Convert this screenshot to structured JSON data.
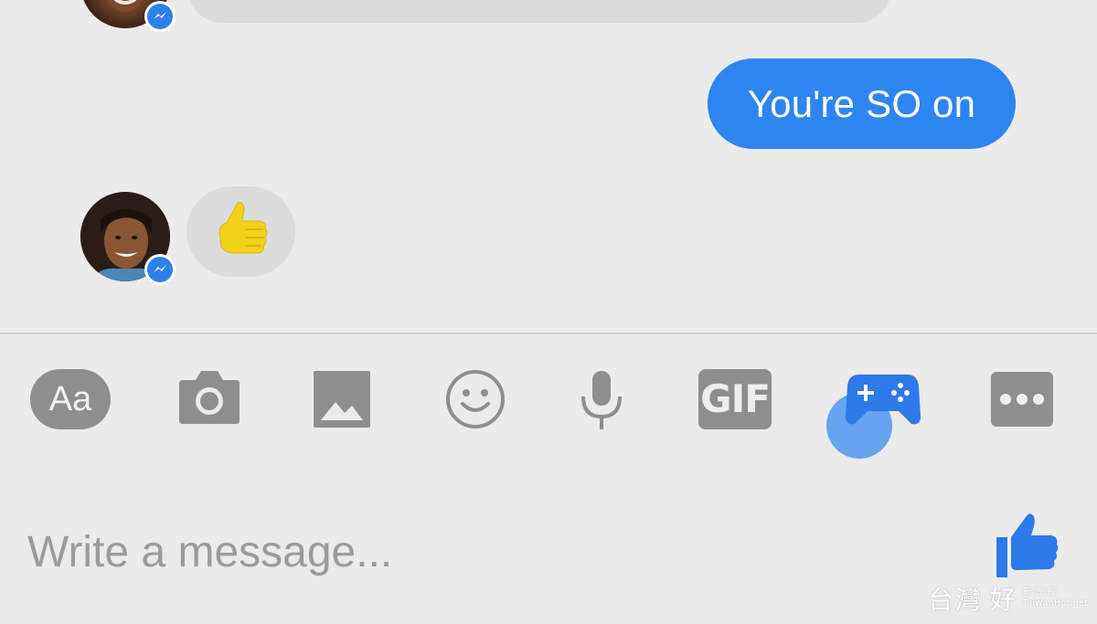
{
  "conversation": {
    "outgoing_message": "You're SO on",
    "incoming_reaction_icon": "thumbs-up-emoji",
    "avatar_badge_icon": "messenger-icon"
  },
  "toolbar": {
    "text_tool_label": "Aa",
    "camera_icon": "camera-icon",
    "gallery_icon": "image-icon",
    "emoji_icon": "smiley-icon",
    "voice_icon": "microphone-icon",
    "gif_label": "GIF",
    "games_icon": "game-controller-icon",
    "games_active": true,
    "more_icon": "more-icon"
  },
  "composer": {
    "placeholder": "Write a message...",
    "send_icon": "thumbs-up-icon"
  },
  "watermark": {
    "text": "台灣",
    "text2": "好",
    "sub": "新 聞 報",
    "site": "TaiwanHot.net"
  },
  "colors": {
    "accent": "#2e85f2",
    "background": "#ebebeb",
    "incoming_bubble": "#dcdcdc",
    "toolbar_icon": "#8e8e8e",
    "emoji_yellow": "#f2d21b"
  }
}
